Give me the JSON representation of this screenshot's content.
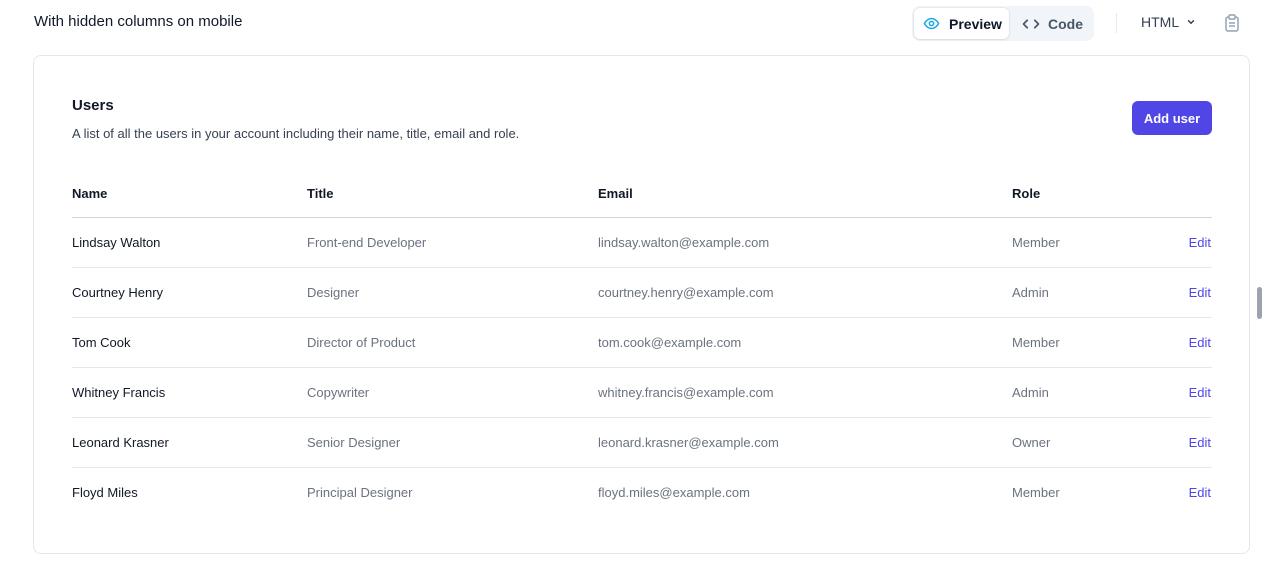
{
  "header": {
    "section_title": "With hidden columns on mobile",
    "preview_label": "Preview",
    "code_label": "Code",
    "language": "HTML"
  },
  "card": {
    "title": "Users",
    "description": "A list of all the users in your account including their name, title, email and role.",
    "add_button": "Add user"
  },
  "table": {
    "columns": [
      "Name",
      "Title",
      "Email",
      "Role"
    ],
    "rows": [
      {
        "name": "Lindsay Walton",
        "title": "Front-end Developer",
        "email": "lindsay.walton@example.com",
        "role": "Member",
        "action": "Edit"
      },
      {
        "name": "Courtney Henry",
        "title": "Designer",
        "email": "courtney.henry@example.com",
        "role": "Admin",
        "action": "Edit"
      },
      {
        "name": "Tom Cook",
        "title": "Director of Product",
        "email": "tom.cook@example.com",
        "role": "Member",
        "action": "Edit"
      },
      {
        "name": "Whitney Francis",
        "title": "Copywriter",
        "email": "whitney.francis@example.com",
        "role": "Admin",
        "action": "Edit"
      },
      {
        "name": "Leonard Krasner",
        "title": "Senior Designer",
        "email": "leonard.krasner@example.com",
        "role": "Owner",
        "action": "Edit"
      },
      {
        "name": "Floyd Miles",
        "title": "Principal Designer",
        "email": "floyd.miles@example.com",
        "role": "Member",
        "action": "Edit"
      }
    ]
  },
  "icons": {
    "preview": "eye-icon",
    "code": "code-brackets-icon",
    "language_dropdown": "chevron-down-icon",
    "copy": "clipboard-icon"
  },
  "colors": {
    "accent": "#4f46e5",
    "preview_icon": "#0ea5e9"
  }
}
